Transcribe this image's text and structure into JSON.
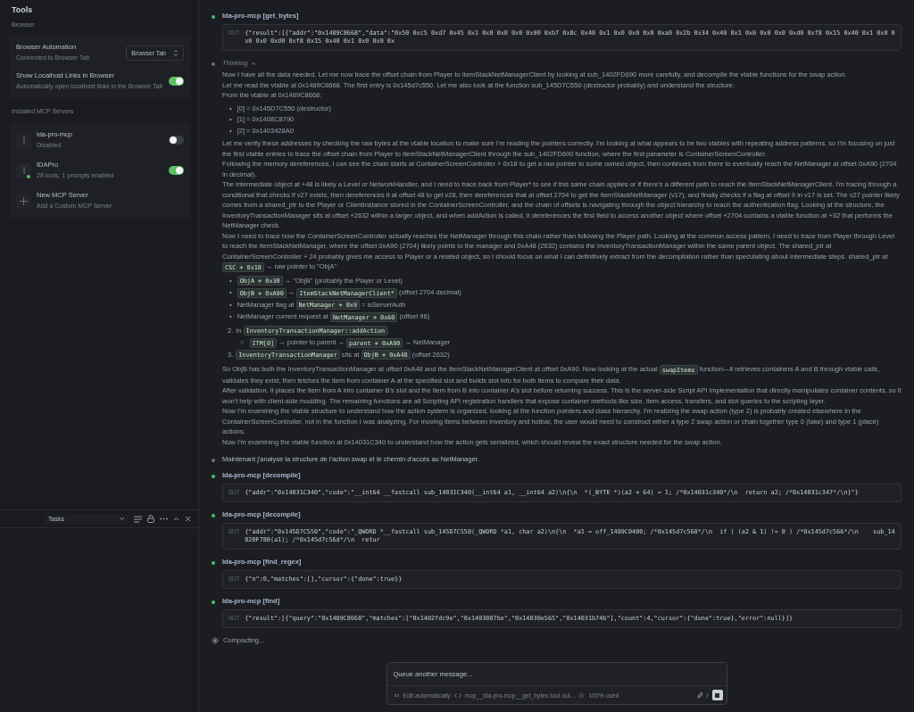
{
  "sidebar": {
    "title": "Tools",
    "browser_section": "Browser",
    "browser_rows": [
      {
        "kind": "select",
        "title": "Browser Automation",
        "subtitle": "Connected to Browser Tab",
        "value": "Browser Tab"
      },
      {
        "kind": "toggle",
        "title": "Show Localhost Links in Browser",
        "subtitle": "Automatically open localhost links in the Browser Tab",
        "on": true
      }
    ],
    "servers_section": "Installed MCP Servers",
    "servers": [
      {
        "kind": "server",
        "name": "ida-pro-mcp",
        "status": "Disabled",
        "connected": false,
        "on": false
      },
      {
        "kind": "server",
        "name": "IDAPro",
        "status": "28 tools, 1 prompts enabled",
        "connected": true,
        "on": true
      },
      {
        "kind": "add",
        "name": "New MCP Server",
        "status": "Add a Custom MCP Server"
      }
    ]
  },
  "tasks_bar": {
    "select": "Tasks"
  },
  "conversation": {
    "steps": [
      {
        "kind": "tool",
        "title": "Ida-pro-mcp [get_bytes]",
        "out_label": "OUT",
        "output": "{\"result\":[{\"addr\":\"0x1489C8668\",\"data\":\"0x50 0xc5 0xd7 0x45 0x1 0x0 0x0 0x0 0x90 0xb7 0x8c 0x40 0x1 0x0 0x0 0x0 0xa0 0x2b 0x34 0x40 0x1 0x0 0x0 0x0 0xd0 0xf8 0x15 0x40 0x1 0x0 0x0 0x0 0xd0 0xf8 0x15 0x40 0x1 0x0 0x0 0x"
      },
      {
        "kind": "thinking",
        "title": "Thinking",
        "expanded": true,
        "blocks": [
          {
            "kind": "paragraph",
            "text": "Now I have all the data needed. Let me now trace the offset chain from Player to ItemStackNetManagerClient by looking at sub_1402FD690 more carefully, and decompile the vtable functions for the swap action."
          },
          {
            "kind": "paragraph",
            "text": "Let me read the vtable at 0x1489C8668. The first entry is 0x145d7c550. Let me also look at the function sub_145D7C550 (destructor probably) and understand the structure."
          },
          {
            "kind": "paragraph",
            "text": "From the vtable at 0x1489C8668:"
          },
          {
            "kind": "bullets",
            "items": [
              {
                "marker": "•",
                "parts": [
                  {
                    "kind": "text",
                    "text": "[0] = 0x145D7C550 (destructor)"
                  }
                ]
              },
              {
                "marker": "•",
                "parts": [
                  {
                    "kind": "text",
                    "text": "[1] = 0x1408C8790"
                  }
                ]
              },
              {
                "marker": "•",
                "parts": [
                  {
                    "kind": "text",
                    "text": "[2] = 0x1403428A0"
                  }
                ]
              }
            ]
          },
          {
            "kind": "paragraph",
            "text": "Let me verify these addresses by checking the raw bytes at the vtable location to make sure I'm reading the pointers correctly. I'm looking at what appears to be two vtables with repeating address patterns, so I'm focusing on just the first vtable entries to trace the offset chain from Player to ItemStackNetManagerClient through the sub_1402FD690 function, where the first parameter is ContainerScreenController."
          },
          {
            "kind": "paragraph",
            "text": "Following the memory dereferences, I can see the chain starts at ContainerScreenController + 0x18 to get a raw pointer to some owned object, then continues from there to eventually reach the NetManager at offset 0xA90 (2704 in decimal)."
          },
          {
            "kind": "paragraph",
            "text": "The intermediate object at +48 is likely a Level or NetworkHandler, and I need to trace back from Player* to see if this same chain applies or if there's a different path to reach the ItemStackNetManagerClient. I'm tracing through a conditional that checks if v27 exists, then dereferences it at offset 48 to get v28, then dereferences that at offset 2704 to get the ItemStackNetManager (v17), and finally checks if a flag at offset 9 in v17 is set. The v27 pointer likely comes from a shared_ptr to the Player or ClientInstance stored in the ContainerScreenController, and the chain of offsets is navigating through the object hierarchy to reach the authentication flag. Looking at the structure, the InventoryTransactionManager sits at offset +2632 within a larger object, and when addAction is called, it dereferences the first field to access another object where offset +2704 contains a vtable function at +32 that performs the NetManager check."
          },
          {
            "kind": "paragraph",
            "parts": [
              {
                "kind": "text",
                "text": "Now I need to trace how the ContainerScreenController actually reaches the NetManager through this chain rather than following the Player path. Looking at the common access pattern, I need to trace from Player through Level to reach the ItemStackNetManager, where the offset 0xA90 (2704) likely points to the manager and 0xA48 (2632) contains the InventoryTransactionManager within the same parent object. The shared_ptr at ContainerScreenController + 24 probably gives me access to Player or a related object, so I should focus on what I can definitively extract from the decompilation rather than speculating about intermediate steps. shared_ptr at "
              },
              {
                "kind": "code",
                "text": "CSC + 0x18"
              },
              {
                "kind": "text",
                "text": " → raw pointer to \"ObjA\""
              }
            ]
          },
          {
            "kind": "bullets",
            "items": [
              {
                "marker": "•",
                "parts": [
                  {
                    "kind": "code",
                    "text": "ObjA + 0x30"
                  },
                  {
                    "kind": "text",
                    "text": " → \"ObjB\" (probably the Player or Level)"
                  }
                ]
              },
              {
                "marker": "•",
                "parts": [
                  {
                    "kind": "code",
                    "text": "ObjB + 0xA90"
                  },
                  {
                    "kind": "text",
                    "text": " → "
                  },
                  {
                    "kind": "code",
                    "text": "ItemStackNetManagerClient*"
                  },
                  {
                    "kind": "text",
                    "text": " (offset 2704 decimal)"
                  }
                ]
              },
              {
                "marker": "•",
                "parts": [
                  {
                    "kind": "text",
                    "text": "NetManager flag at "
                  },
                  {
                    "kind": "code",
                    "text": "NetManager + 0x9"
                  },
                  {
                    "kind": "text",
                    "text": " = isServerAuth"
                  }
                ]
              },
              {
                "marker": "•",
                "parts": [
                  {
                    "kind": "text",
                    "text": "NetManager current request at "
                  },
                  {
                    "kind": "code",
                    "text": "NetManager + 0x60"
                  },
                  {
                    "kind": "text",
                    "text": " (offset 96)"
                  }
                ]
              }
            ]
          },
          {
            "kind": "numbered",
            "items": [
              {
                "number": "2.",
                "parts": [
                  {
                    "kind": "text",
                    "text": "In "
                  },
                  {
                    "kind": "code",
                    "text": "InventoryTransactionManager::addAction"
                  },
                  {
                    "kind": "text",
                    "text": ":"
                  }
                ],
                "children": [
                  {
                    "marker": "○",
                    "parts": [
                      {
                        "kind": "code",
                        "text": "ITM[0]"
                      },
                      {
                        "kind": "text",
                        "text": " → pointer to parent → "
                      },
                      {
                        "kind": "code",
                        "text": "parent + 0xA90"
                      },
                      {
                        "kind": "text",
                        "text": " → NetManager"
                      }
                    ]
                  }
                ]
              },
              {
                "number": "3.",
                "parts": [
                  {
                    "kind": "code",
                    "text": "InventoryTransactionManager"
                  },
                  {
                    "kind": "text",
                    "text": " sits at "
                  },
                  {
                    "kind": "code",
                    "text": "ObjB + 0xA48"
                  },
                  {
                    "kind": "text",
                    "text": " (offset 2632)"
                  }
                ]
              }
            ]
          },
          {
            "kind": "paragraph",
            "parts": [
              {
                "kind": "text",
                "text": "So ObjB has both the InventoryTransactionManager at offset 0xA48 and the ItemStackNetManagerClient at offset 0xA90. Now looking at the actual "
              },
              {
                "kind": "code",
                "text": "swapItems"
              },
              {
                "kind": "text",
                "text": " function—it retrieves containers A and B through vtable calls, validates they exist, then fetches the item from container A at the specified slot and builds slot info for both items to compare their data."
              }
            ]
          },
          {
            "kind": "paragraph",
            "text": "After validation, it places the item from A into container B's slot and the item from B into container A's slot before returning success. This is the server-side Script API implementation that directly manipulates container contents, so it won't help with client-side modding. The remaining functions are all Scripting API registration handlers that expose container methods like size, item access, transfers, and slot queries to the scripting layer."
          },
          {
            "kind": "paragraph",
            "text": "Now I'm examining the vtable structure to understand how the action system is organized, looking at the function pointers and class hierarchy. I'm realizing the swap action (type 2) is probably created elsewhere in the ContainerScreenController, not in the function I was analyzing. For moving items between inventory and hotbar, the user would need to construct either a type 2 swap action or chain together type 0 (take) and type 1 (place) actions."
          },
          {
            "kind": "paragraph",
            "text": "Now I'm examining the vtable function at 0x14031C340 to understand how the action gets serialized, which should reveal the exact structure needed for the swap action."
          }
        ]
      },
      {
        "kind": "text",
        "text": "Maintenant j'analyse la structure de l'action swap et le chemin d'accès au NetManager."
      },
      {
        "kind": "tool",
        "title": "Ida-pro-mcp [decompile]",
        "out_label": "OUT",
        "output": "{\"addr\":\"0x14031C340\",\"code\":\"__int64 __fastcall sub_14031C340(__int64 a1, __int64 a2)\\n{\\n  *(_BYTE *)(a2 + 64) = 1; /*0x14031c340*/\\n  return a2; /*0x14031c347*/\\n}\"}"
      },
      {
        "kind": "tool",
        "title": "Ida-pro-mcp [decompile]",
        "out_label": "OUT",
        "output": "{\"addr\":\"0x145D7C550\",\"code\":\"_QWORD *__fastcall sub_145D7C550(_QWORD *a1, char a2)\\n{\\n  *a1 = off_1489C0400; /*0x145d7c560*/\\n  if ( (a2 & 1) != 0 ) /*0x145d7c566*/\\n    sub_14820F780(a1); /*0x145d7c56d*/\\n  retur"
      },
      {
        "kind": "tool",
        "title": "Ida-pro-mcp [find_regex]",
        "out_label": "OUT",
        "output": "{\"n\":0,\"matches\":[],\"cursor\":{\"done\":true}}"
      },
      {
        "kind": "tool",
        "title": "Ida-pro-mcp [find]",
        "out_label": "OUT",
        "output": "{\"result\":[{\"query\":\"0x1489C8668\",\"matches\":[\"0x1402fdc9e\",\"0x1403007be\",\"0x14030e565\",\"0x14031b74b\"],\"count\":4,\"cursor\":{\"done\":true},\"error\":null}]}"
      }
    ],
    "status": "Compacting..."
  },
  "composer": {
    "placeholder": "Queue another message...",
    "mode": "Edit automatically",
    "context": "mcp__ida-pro-mcp__get_bytes tool out...",
    "usage": "100% used",
    "command": "/"
  }
}
